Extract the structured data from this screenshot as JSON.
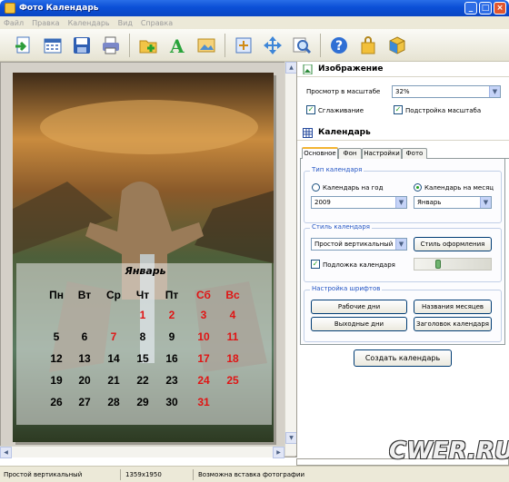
{
  "window": {
    "title": "Фото Календарь"
  },
  "menu": [
    "Файл",
    "Правка",
    "Календарь",
    "Вид",
    "Справка"
  ],
  "toolbar": {
    "icons": [
      "open-icon",
      "calendar-icon",
      "save-icon",
      "print-icon",
      "add-photo-icon",
      "text-icon",
      "image-icon",
      "fit-icon",
      "move-icon",
      "zoom-icon",
      "help-icon",
      "shopping-bag-icon",
      "box-icon"
    ]
  },
  "image_section": {
    "title": "Изображение",
    "zoom_label": "Просмотр в масштабе",
    "zoom_value": "32%",
    "smoothing_label": "Сглаживание",
    "smoothing_checked": true,
    "fit_scale_label": "Подстройка масштаба",
    "fit_scale_checked": true
  },
  "calendar_section": {
    "title": "Календарь",
    "tabs": [
      "Основное",
      "Фон",
      "Настройки",
      "Фото"
    ],
    "active_tab": "Основное",
    "type_group": {
      "title": "Тип календаря",
      "option_year": "Календарь на год",
      "option_month": "Календарь на месяц",
      "selected": "month",
      "year_value": "2009",
      "month_value": "Январь"
    },
    "style_group": {
      "title": "Стиль календаря",
      "style_value": "Простой вертикальный",
      "design_button": "Стиль оформления",
      "underlay_label": "Подложка календаря",
      "underlay_checked": true,
      "opacity_level": 0.3
    },
    "fonts_group": {
      "title": "Настройка шрифтов",
      "workdays_button": "Рабочие дни",
      "month_names_button": "Названия месяцев",
      "weekends_button": "Выходные дни",
      "header_button": "Заголовок календаря"
    },
    "create_button": "Создать календарь"
  },
  "preview": {
    "month": "Январь",
    "weekdays": [
      "Пн",
      "Вт",
      "Ср",
      "Чт",
      "Пт",
      "Сб",
      "Вс"
    ],
    "weeks": [
      [
        "",
        "",
        "",
        "1",
        "2",
        "3",
        "4"
      ],
      [
        "5",
        "6",
        "7",
        "8",
        "9",
        "10",
        "11"
      ],
      [
        "12",
        "13",
        "14",
        "15",
        "16",
        "17",
        "18"
      ],
      [
        "19",
        "20",
        "21",
        "22",
        "23",
        "24",
        "25"
      ],
      [
        "26",
        "27",
        "28",
        "29",
        "30",
        "31",
        ""
      ]
    ],
    "red_days": [
      "1",
      "2",
      "3",
      "4",
      "7",
      "10",
      "11",
      "17",
      "18",
      "24",
      "25",
      "31"
    ]
  },
  "status": {
    "style": "Простой вертикальный",
    "size": "1359x1950",
    "hint": "Возможна вставка фотографии"
  },
  "watermark": "CWER.RU",
  "colors": {
    "accent": "#0b4fd6",
    "red_day": "#e01414",
    "group_title": "#2355c4"
  }
}
